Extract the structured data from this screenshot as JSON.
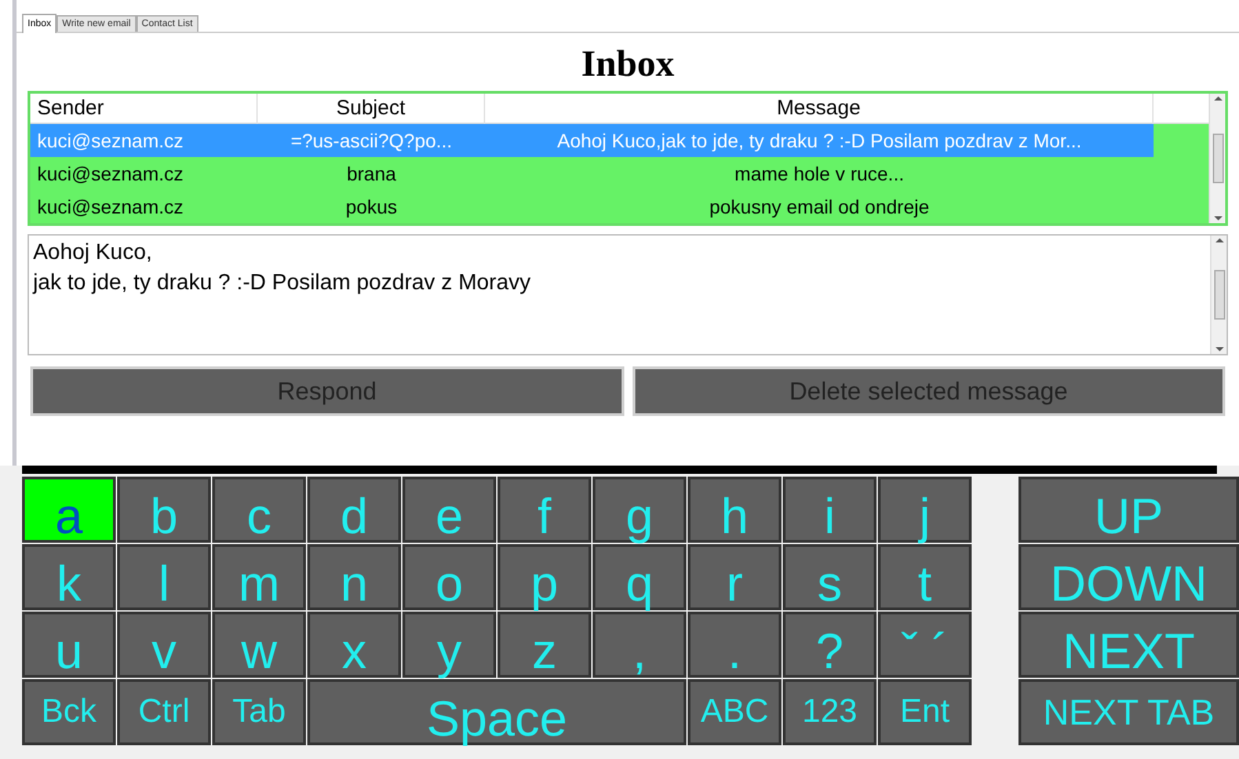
{
  "tabs": [
    {
      "label": "Inbox",
      "selected": true
    },
    {
      "label": "Write new email",
      "selected": false
    },
    {
      "label": "Contact List",
      "selected": false
    }
  ],
  "title": "Inbox",
  "table": {
    "columns": [
      "Sender",
      "Subject",
      "Message"
    ],
    "rows": [
      {
        "cells": [
          "kuci@seznam.cz",
          "=?us-ascii?Q?po...",
          "Aohoj Kuco,jak to jde, ty draku ? :-D Posilam pozdrav z Mor..."
        ],
        "selected": true
      },
      {
        "cells": [
          "kuci@seznam.cz",
          "brana",
          "mame hole v ruce..."
        ],
        "selected": false
      },
      {
        "cells": [
          "kuci@seznam.cz",
          "pokus",
          "pokusny email od ondreje"
        ],
        "selected": false
      }
    ]
  },
  "message_body": [
    "Aohoj Kuco,",
    "jak to jde, ty draku ? :-D Posilam pozdrav z Moravy"
  ],
  "buttons": [
    "Respond",
    "Delete selected message"
  ],
  "keyboard": {
    "letter_rows": [
      [
        {
          "label": "a",
          "selected": true
        },
        {
          "label": "b",
          "selected": false
        },
        {
          "label": "c",
          "selected": false
        },
        {
          "label": "d",
          "selected": false
        },
        {
          "label": "e",
          "selected": false
        },
        {
          "label": "f",
          "selected": false
        },
        {
          "label": "g",
          "selected": false
        },
        {
          "label": "h",
          "selected": false
        },
        {
          "label": "i",
          "selected": false
        },
        {
          "label": "j",
          "selected": false
        }
      ],
      [
        {
          "label": "k",
          "selected": false
        },
        {
          "label": "l",
          "selected": false
        },
        {
          "label": "m",
          "selected": false
        },
        {
          "label": "n",
          "selected": false
        },
        {
          "label": "o",
          "selected": false
        },
        {
          "label": "p",
          "selected": false
        },
        {
          "label": "q",
          "selected": false
        },
        {
          "label": "r",
          "selected": false
        },
        {
          "label": "s",
          "selected": false
        },
        {
          "label": "t",
          "selected": false
        }
      ],
      [
        {
          "label": "u",
          "selected": false
        },
        {
          "label": "v",
          "selected": false
        },
        {
          "label": "w",
          "selected": false
        },
        {
          "label": "x",
          "selected": false
        },
        {
          "label": "y",
          "selected": false
        },
        {
          "label": "z",
          "selected": false
        },
        {
          "label": ",",
          "selected": false
        },
        {
          "label": ".",
          "selected": false
        },
        {
          "label": "?",
          "selected": false
        },
        {
          "label": "ˇ ´",
          "selected": false
        }
      ]
    ],
    "bottom_row": [
      {
        "label": "Bck",
        "kind": "key",
        "selected": false
      },
      {
        "label": "Ctrl",
        "kind": "key",
        "selected": false
      },
      {
        "label": "Tab",
        "kind": "key",
        "selected": false
      },
      {
        "label": "Space",
        "kind": "space",
        "selected": false
      },
      {
        "label": "ABC",
        "kind": "key",
        "selected": false
      },
      {
        "label": "123",
        "kind": "key",
        "selected": false
      },
      {
        "label": "Ent",
        "kind": "key",
        "selected": false
      }
    ],
    "side_keys": [
      {
        "label": "UP",
        "selected": false
      },
      {
        "label": "DOWN",
        "selected": false
      },
      {
        "label": "NEXT",
        "selected": false
      },
      {
        "label": "NEXT TAB",
        "selected": false
      }
    ]
  }
}
